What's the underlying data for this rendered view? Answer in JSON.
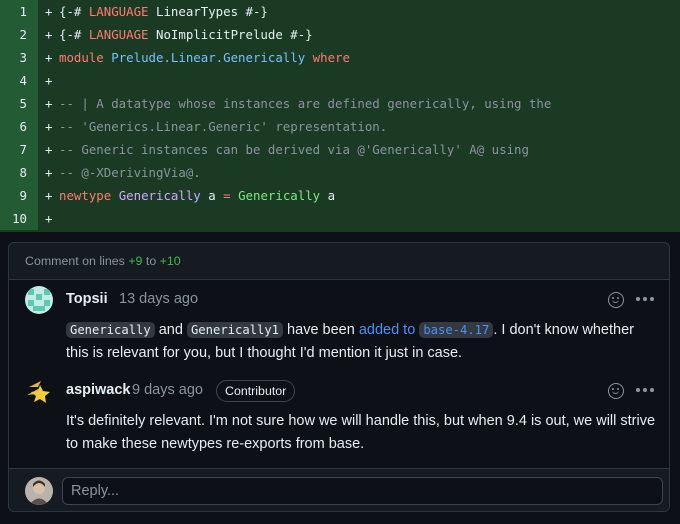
{
  "diff": {
    "lines": [
      {
        "num": "1",
        "plus": "+",
        "tokens": [
          {
            "t": "{-# ",
            "c": ""
          },
          {
            "t": "LANGUAGE",
            "c": "kw"
          },
          {
            "t": " LinearTypes #-}",
            "c": ""
          }
        ]
      },
      {
        "num": "2",
        "plus": "+",
        "tokens": [
          {
            "t": "{-# ",
            "c": ""
          },
          {
            "t": "LANGUAGE",
            "c": "kw"
          },
          {
            "t": " NoImplicitPrelude #-}",
            "c": ""
          }
        ]
      },
      {
        "num": "3",
        "plus": "+",
        "tokens": [
          {
            "t": "module",
            "c": "kw"
          },
          {
            "t": " ",
            "c": ""
          },
          {
            "t": "Prelude.Linear.Generically",
            "c": "ty"
          },
          {
            "t": " ",
            "c": ""
          },
          {
            "t": "where",
            "c": "kw"
          }
        ]
      },
      {
        "num": "4",
        "plus": "+",
        "tokens": []
      },
      {
        "num": "5",
        "plus": "+",
        "tokens": [
          {
            "t": "-- | A datatype whose instances are defined generically, using the",
            "c": "cm"
          }
        ]
      },
      {
        "num": "6",
        "plus": "+",
        "tokens": [
          {
            "t": "-- 'Generics.Linear.Generic' representation.",
            "c": "cm"
          }
        ]
      },
      {
        "num": "7",
        "plus": "+",
        "tokens": [
          {
            "t": "-- Generic instances can be derived via @'Generically' A@ using",
            "c": "cm"
          }
        ]
      },
      {
        "num": "8",
        "plus": "+",
        "tokens": [
          {
            "t": "-- @-XDerivingVia@.",
            "c": "cm"
          }
        ]
      },
      {
        "num": "9",
        "plus": "+",
        "tokens": [
          {
            "t": "newtype",
            "c": "kw"
          },
          {
            "t": " ",
            "c": ""
          },
          {
            "t": "Generically",
            "c": "cn"
          },
          {
            "t": " a ",
            "c": ""
          },
          {
            "t": "=",
            "c": "kw"
          },
          {
            "t": " ",
            "c": ""
          },
          {
            "t": "Generically",
            "c": "fn"
          },
          {
            "t": " a",
            "c": ""
          }
        ]
      },
      {
        "num": "10",
        "plus": "+",
        "tokens": []
      }
    ]
  },
  "thread": {
    "header": {
      "prefix": "Comment on lines ",
      "from": "+9",
      "mid": " to ",
      "to": "+10"
    },
    "comments": [
      {
        "author": "Topsii",
        "time": "13 days ago",
        "body": {
          "chip1": "Generically",
          "and": " and ",
          "chip2": "Generically1",
          "have_been": " have been ",
          "added_to": "added to",
          "chip3": "base-4.17",
          "rest": ". I don't know whether this is relevant for you, but I thought I'd mention it just in case."
        }
      },
      {
        "author": "aspiwack",
        "time": "9 days ago",
        "badge": "Contributor",
        "body_text": "It's definitely relevant. I'm not sure how we will handle this, but when 9.4 is out, we will strive to make these newtypes re-exports from base."
      }
    ],
    "reply_placeholder": "Reply..."
  },
  "icons": {
    "emoji": "smiley-icon",
    "menu": "kebab-horizontal-icon"
  },
  "colors": {
    "added_line_bg": "#1a3a24",
    "added_gutter_bg": "#235c34",
    "keyword": "#ff7b72",
    "type": "#79c0ff",
    "comment": "#8b949e",
    "link": "#4493f8",
    "green": "#3fb950"
  }
}
